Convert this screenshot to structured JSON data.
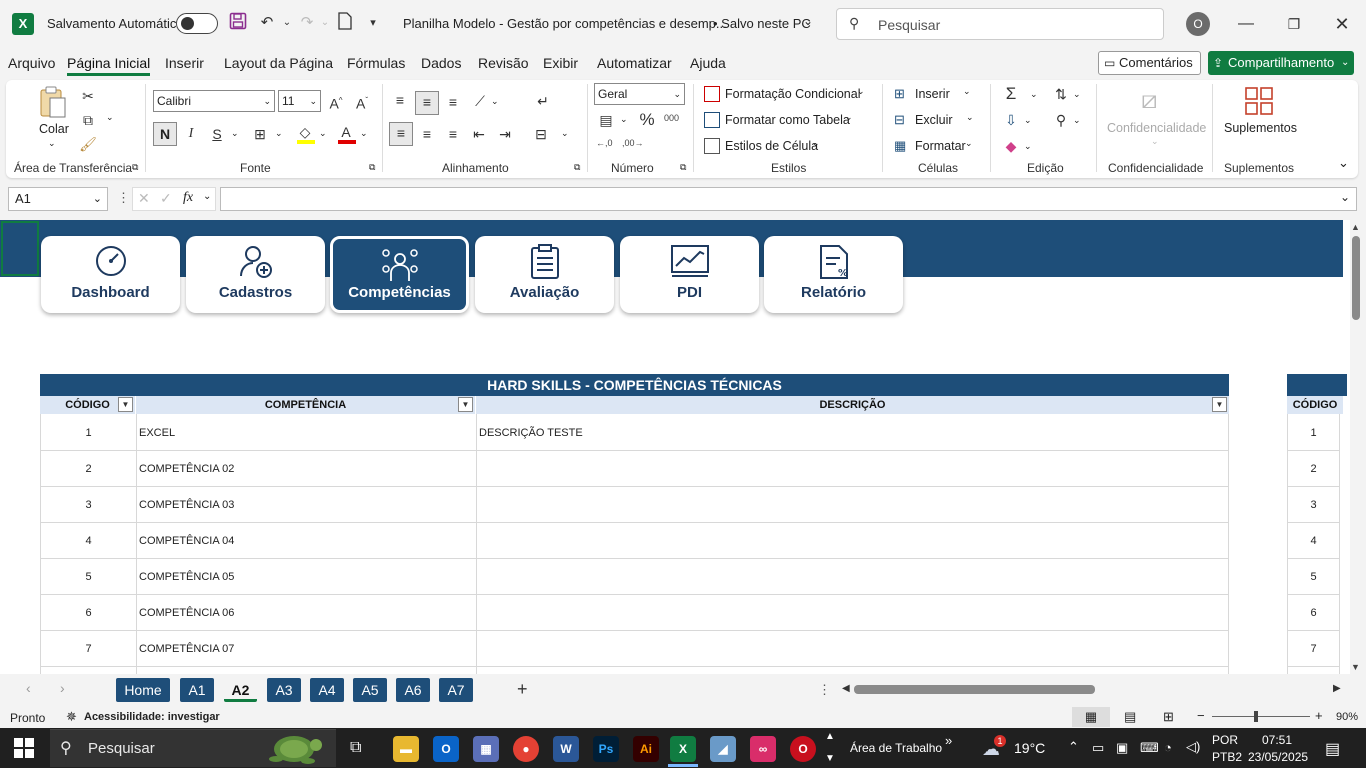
{
  "titlebar": {
    "autosave_label": "Salvamento Automático",
    "doc_title": "Planilha Modelo - Gestão por competências e desemp...",
    "save_state": "• Salvo neste PC",
    "search_placeholder": "Pesquisar",
    "avatar_initial": "O"
  },
  "menu": {
    "items": [
      "Arquivo",
      "Página Inicial",
      "Inserir",
      "Layout da Página",
      "Fórmulas",
      "Dados",
      "Revisão",
      "Exibir",
      "Automatizar",
      "Ajuda"
    ],
    "comments_label": "Comentários",
    "share_label": "Compartilhamento"
  },
  "ribbon": {
    "clipboard": {
      "paste_label": "Colar",
      "group_label": "Área de Transferência"
    },
    "font": {
      "name": "Calibri",
      "size": "11",
      "group_label": "Fonte",
      "bold": "N",
      "italic": "I",
      "underline": "S"
    },
    "alignment": {
      "group_label": "Alinhamento"
    },
    "number": {
      "format": "Geral",
      "group_label": "Número"
    },
    "styles": {
      "conditional": "Formatação Condicional",
      "as_table": "Formatar como Tabela",
      "cell_styles": "Estilos de Célula",
      "group_label": "Estilos"
    },
    "cells": {
      "insert": "Inserir",
      "delete": "Excluir",
      "format": "Formatar",
      "group_label": "Células"
    },
    "editing": {
      "group_label": "Edição"
    },
    "sensitivity": {
      "label": "Confidencialidade",
      "group_label": "Confidencialidade"
    },
    "addins": {
      "label": "Suplementos",
      "group_label": "Suplementos"
    }
  },
  "formula_bar": {
    "name_box": "A1",
    "fx": "fx",
    "value": ""
  },
  "nav_cards": [
    {
      "label": "Dashboard",
      "icon": "gauge-icon"
    },
    {
      "label": "Cadastros",
      "icon": "user-add-icon"
    },
    {
      "label": "Competências",
      "icon": "competencies-icon"
    },
    {
      "label": "Avaliação",
      "icon": "clipboard-icon"
    },
    {
      "label": "PDI",
      "icon": "chart-icon"
    },
    {
      "label": "Relatório",
      "icon": "report-icon"
    }
  ],
  "table": {
    "title": "HARD SKILLS - COMPETÊNCIAS TÉCNICAS",
    "columns": [
      "CÓDIGO",
      "COMPETÊNCIA",
      "DESCRIÇÃO"
    ],
    "rows": [
      {
        "code": "1",
        "name": "EXCEL",
        "desc": "DESCRIÇÃO TESTE"
      },
      {
        "code": "2",
        "name": "COMPETÊNCIA 02",
        "desc": ""
      },
      {
        "code": "3",
        "name": "COMPETÊNCIA 03",
        "desc": ""
      },
      {
        "code": "4",
        "name": "COMPETÊNCIA 04",
        "desc": ""
      },
      {
        "code": "5",
        "name": "COMPETÊNCIA 05",
        "desc": ""
      },
      {
        "code": "6",
        "name": "COMPETÊNCIA 06",
        "desc": ""
      },
      {
        "code": "7",
        "name": "COMPETÊNCIA 07",
        "desc": ""
      }
    ]
  },
  "table2": {
    "column": "CÓDIGO",
    "codes": [
      "1",
      "2",
      "3",
      "4",
      "5",
      "6",
      "7"
    ]
  },
  "sheet_tabs": [
    "Home",
    "A1",
    "A2",
    "A3",
    "A4",
    "A5",
    "A6",
    "A7"
  ],
  "active_tab": "A2",
  "status": {
    "ready": "Pronto",
    "accessibility": "Acessibilidade: investigar",
    "zoom": "90%"
  },
  "taskbar": {
    "search": "Pesquisar",
    "desktop_label": "Área de Trabalho",
    "temperature": "19°C",
    "weather_badge": "1",
    "lang": "POR",
    "layout": "PTB2",
    "time": "07:51",
    "date": "23/05/2025"
  },
  "colors": {
    "excel_green": "#107c41",
    "navy": "#1e4e79",
    "header_fill": "#dce6f4"
  }
}
